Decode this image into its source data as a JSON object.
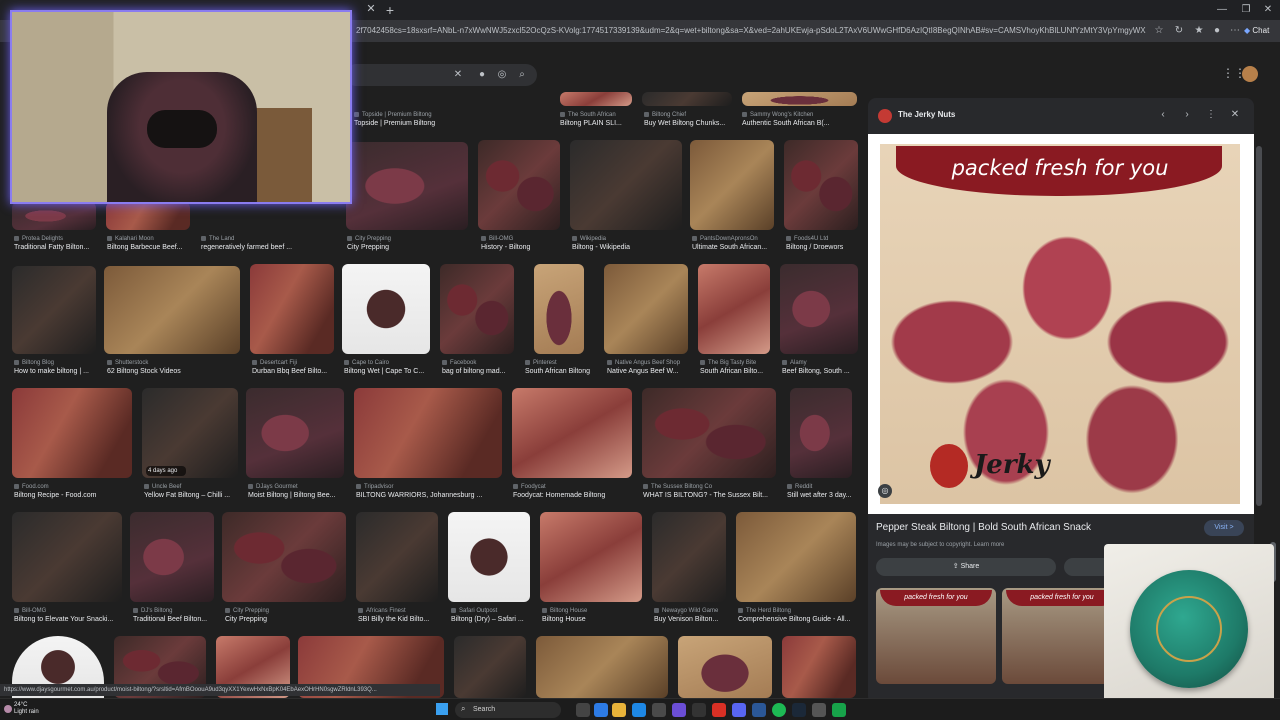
{
  "browser": {
    "url": "2f7042458cs=18sxsrf=ANbL-n7xWwNWJ5zxcl52OcQzS-KVolg:1774517339139&udm=2&q=wet+biltong&sa=X&ved=2ahUKEwja-pSdoL2TAxV6UWwGHfD6AzIQtI8BegQINhAB#sv=CAMSVhoyKhBlLUNfYzMtY3VpYmgyWXNNMgSDX2MzLWN1aWJoMlIzT...",
    "chat_label": "Chat"
  },
  "grid": [
    {
      "source": "Topside | Premium Biltong",
      "caption": "Topside | Premium Biltong"
    },
    {
      "source": "The South African",
      "caption": "Biltong PLAIN SLI..."
    },
    {
      "source": "Biltong Chief",
      "caption": "Buy Wet Biltong Chunks..."
    },
    {
      "source": "Sammy Wong's Kitchen",
      "caption": "Authentic South African B(..."
    },
    {
      "source": "Protea Delights",
      "caption": "Traditional Fatty Bilton..."
    },
    {
      "source": "Kalahari Moon",
      "caption": "Biltong Barbecue Beef..."
    },
    {
      "source": "The Land",
      "caption": "regeneratively farmed beef ..."
    },
    {
      "source": "City Prepping",
      "caption": "City Prepping"
    },
    {
      "source": "Bill-OMG",
      "caption": "History - Biltong"
    },
    {
      "source": "Wikipedia",
      "caption": "Biltong - Wikipedia"
    },
    {
      "source": "PantsDownApronsOn",
      "caption": "Ultimate South African..."
    },
    {
      "source": "Foods4U Ltd",
      "caption": "Biltong / Droewors"
    },
    {
      "source": "Biltong Blog",
      "caption": "How to make biltong | ..."
    },
    {
      "source": "Shutterstock",
      "caption": "62 Biltong Stock Videos"
    },
    {
      "source": "Desertcart Fiji",
      "caption": "Durban Bbq Beef Bilto..."
    },
    {
      "source": "Cape to Cairo",
      "caption": "Biltong Wet | Cape To C..."
    },
    {
      "source": "Facebook",
      "caption": "bag of biltong mad..."
    },
    {
      "source": "Pinterest",
      "caption": "South African Biltong"
    },
    {
      "source": "Native Angus Beef Shop",
      "caption": "Native Angus Beef W..."
    },
    {
      "source": "The Big Tasty Bite",
      "caption": "South African Bilto..."
    },
    {
      "source": "Alamy",
      "caption": "Beef Biltong, South ..."
    },
    {
      "source": "Food.com",
      "caption": "Biltong Recipe - Food.com"
    },
    {
      "source": "Uncle Beef",
      "caption": "Yellow Fat Biltong – Chilli ..."
    },
    {
      "source": "DJays Gourmet",
      "caption": "Moist Biltong | Biltong Bee..."
    },
    {
      "source": "Tripadvisor",
      "caption": "BILTONG WARRIORS, Johannesburg ..."
    },
    {
      "source": "Foodycat",
      "caption": "Foodycat: Homemade Biltong"
    },
    {
      "source": "The Sussex Biltong Co",
      "caption": "WHAT IS BILTONG? - The Sussex Bilt..."
    },
    {
      "source": "Reddit",
      "caption": "Still wet after 3 day..."
    },
    {
      "source": "Bill-OMG",
      "caption": "Biltong to Elevate Your Snacki..."
    },
    {
      "source": "DJ's Biltong",
      "caption": "Traditional Beef Bilton..."
    },
    {
      "source": "City Prepping",
      "caption": "City Prepping"
    },
    {
      "source": "Africans Finest",
      "caption": "SBI Billy the Kid Bilto..."
    },
    {
      "source": "Safari Outpost",
      "caption": "Biltong (Dry) – Safari ..."
    },
    {
      "source": "Biltong House",
      "caption": "Biltong House"
    },
    {
      "source": "Newaygo Wild Game",
      "caption": "Buy Venison Bilton..."
    },
    {
      "source": "The Herd Biltong",
      "caption": "Comprehensive Biltong Guide - All..."
    }
  ],
  "age_badge": "4 days ago",
  "panel": {
    "site": "The Jerky Nuts",
    "banner": "packed fresh for you",
    "brand_text": "Jerky",
    "title": "Pepper Steak Biltong | Bold South African Snack",
    "visit": "Visit >",
    "copyright": "Images may be subject to copyright. Learn more",
    "share": "Share",
    "related_banner": "packed fresh for you"
  },
  "status_url": "https://www.djaysgourmet.com.au/product/moist-biltong/?srsltid=AfmBOoouA9ud3qyXX1YexwHxNxBpK04EbAexOHrHN0sgwZRldnL393Q...",
  "taskbar": {
    "weather_temp": "24°C",
    "weather_desc": "Light rain",
    "search_label": "Search"
  }
}
